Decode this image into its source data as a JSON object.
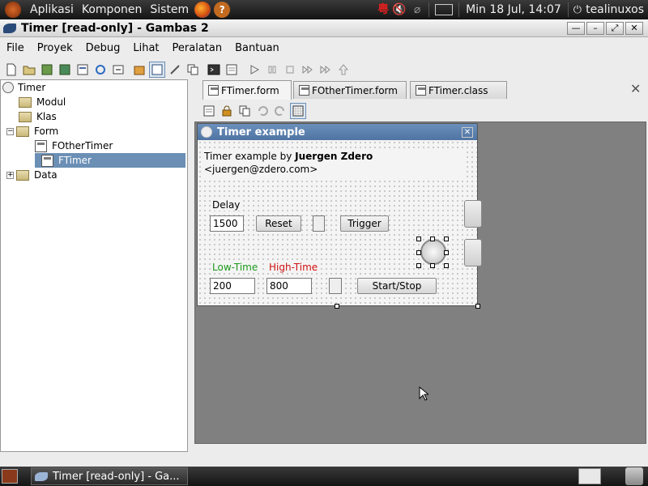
{
  "topbar": {
    "menus": [
      "Aplikasi",
      "Komponen",
      "Sistem"
    ],
    "clock": "Min 18 Jul, 14:07",
    "user": "tealinuxos"
  },
  "window": {
    "title": "Timer [read-only] - Gambas 2"
  },
  "menubar": {
    "items": [
      "File",
      "Proyek",
      "Debug",
      "Lihat",
      "Peralatan",
      "Bantuan"
    ]
  },
  "tree": {
    "root": "Timer",
    "items": [
      "Modul",
      "Klas",
      "Form",
      "FOtherTimer",
      "FTimer",
      "Data"
    ]
  },
  "tabs": [
    "FTimer.form",
    "FOtherTimer.form",
    "FTimer.class"
  ],
  "form": {
    "title": "Timer example",
    "credit_prefix": "Timer example by ",
    "credit_author": "Juergen Zdero",
    "credit_email": "<juergen@zdero.com>",
    "delay_label": "Delay",
    "delay_value": "1500",
    "reset_label": "Reset",
    "trigger_label": "Trigger",
    "low_time_label": "Low-Time",
    "high_time_label": "High-Time",
    "low_time_value": "200",
    "high_time_value": "800",
    "startstop_label": "Start/Stop",
    "low_time_color": "#1a9a1a",
    "high_time_color": "#d01010"
  },
  "taskbar": {
    "task_label": "Timer [read-only] - Ga..."
  },
  "colors": {
    "selection": "#6b8fb5",
    "form_title": "#5a7fad",
    "design_bg": "#808080"
  }
}
